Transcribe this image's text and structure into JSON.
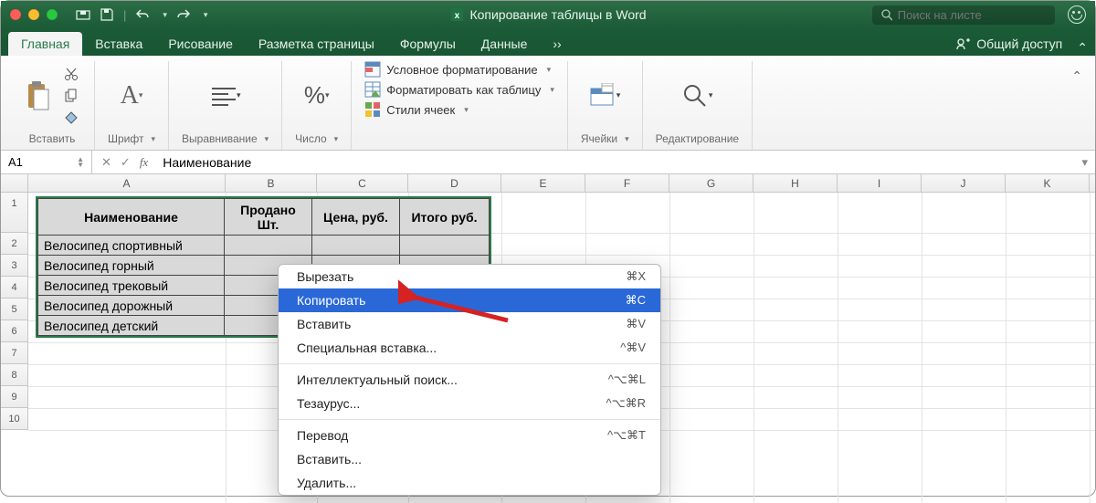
{
  "titlebar": {
    "doc_title": "Копирование таблицы в Word",
    "search_placeholder": "Поиск на листе"
  },
  "tabs": {
    "items": [
      "Главная",
      "Вставка",
      "Рисование",
      "Разметка страницы",
      "Формулы",
      "Данные"
    ],
    "active": 0,
    "share": "Общий доступ"
  },
  "ribbon": {
    "paste": "Вставить",
    "font": "Шрифт",
    "align": "Выравнивание",
    "number": "Число",
    "cond_fmt": "Условное форматирование",
    "as_table": "Форматировать как таблицу",
    "cell_styles": "Стили ячеек",
    "cells": "Ячейки",
    "editing": "Редактирование"
  },
  "formula_bar": {
    "cell_ref": "A1",
    "value": "Наименование"
  },
  "columns": [
    "A",
    "B",
    "C",
    "D",
    "E",
    "F",
    "G",
    "H",
    "I",
    "J",
    "K"
  ],
  "row_numbers": [
    "1",
    "2",
    "3",
    "4",
    "5",
    "6",
    "7",
    "8",
    "9",
    "10"
  ],
  "table": {
    "headers": [
      "Наименование",
      "Продано Шт.",
      "Цена, руб.",
      "Итого руб."
    ],
    "rows": [
      [
        "Велосипед спортивный"
      ],
      [
        "Велосипед горный"
      ],
      [
        "Велосипед трековый"
      ],
      [
        "Велосипед дорожный"
      ],
      [
        "Велосипед детский"
      ]
    ]
  },
  "context_menu": {
    "items": [
      {
        "label": "Вырезать",
        "shortcut": "⌘X"
      },
      {
        "label": "Копировать",
        "shortcut": "⌘C",
        "selected": true
      },
      {
        "label": "Вставить",
        "shortcut": "⌘V"
      },
      {
        "label": "Специальная вставка...",
        "shortcut": "^⌘V"
      },
      {
        "sep": true
      },
      {
        "label": "Интеллектуальный поиск...",
        "shortcut": "^⌥⌘L"
      },
      {
        "label": "Тезаурус...",
        "shortcut": "^⌥⌘R"
      },
      {
        "sep": true
      },
      {
        "label": "Перевод",
        "shortcut": "^⌥⌘T"
      },
      {
        "label": "Вставить..."
      },
      {
        "label": "Удалить..."
      }
    ]
  }
}
